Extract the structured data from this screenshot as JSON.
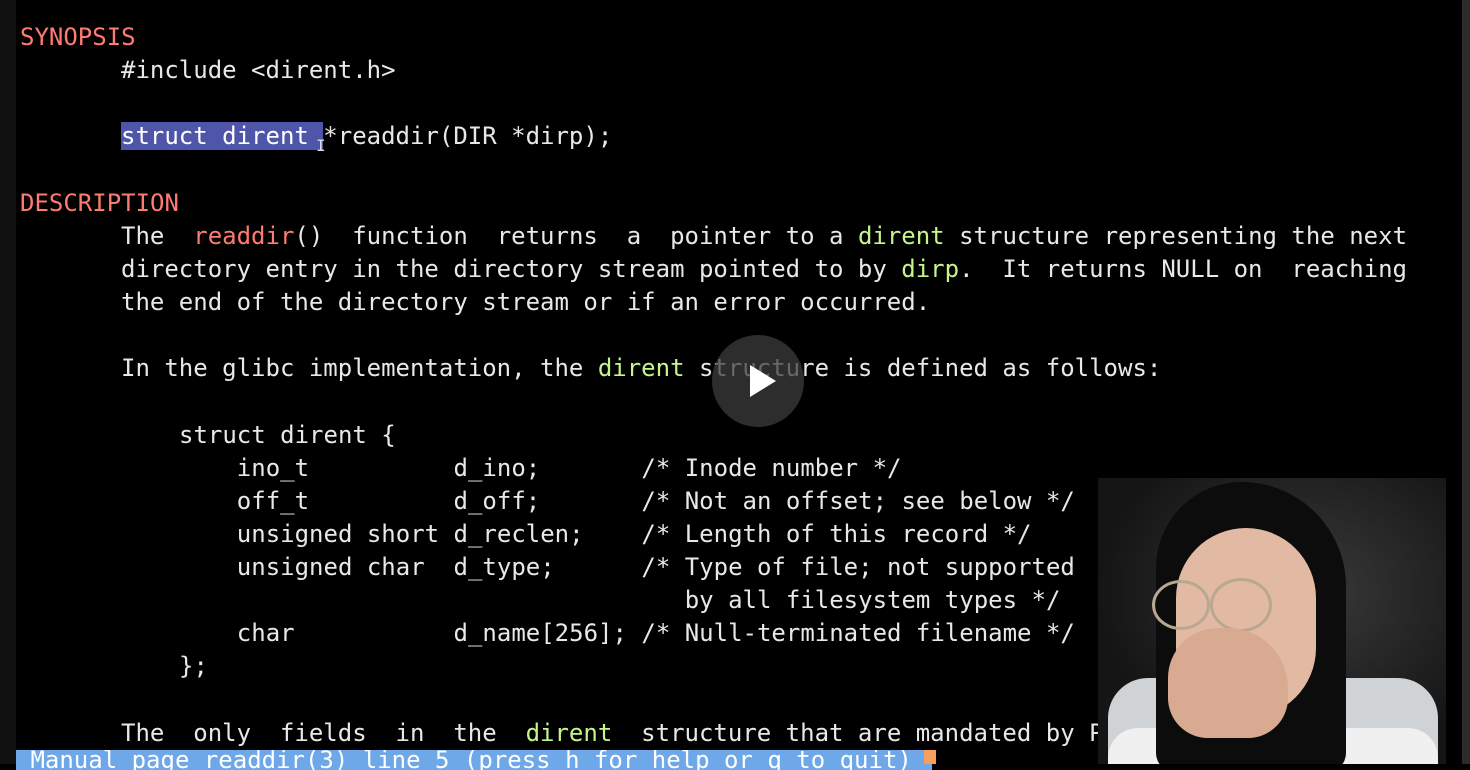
{
  "man_page": {
    "synopsis_header": "SYNOPSIS",
    "include_line": "#include <dirent.h>",
    "proto_selected": "struct dirent ",
    "proto_rest": "*readdir(DIR *dirp);",
    "description_header": "DESCRIPTION",
    "desc_p1_l1": {
      "a": "The  ",
      "fn": "readdir",
      "b": "()  function  returns  a  pointer to a ",
      "kw": "dirent",
      "c": " structure representing the next"
    },
    "desc_p1_l2": {
      "a": "directory entry in the directory stream pointed to by ",
      "kw": "dirp",
      "b": ".  It returns NULL on  reaching"
    },
    "desc_p1_l3": "the end of the directory stream or if an error occurred.",
    "desc_p2": {
      "a": "In the glibc implementation, the ",
      "kw": "dirent",
      "b": " structure is defined as follows:"
    },
    "struct_lines": [
      "struct dirent {",
      "    ino_t          d_ino;       /* Inode number */",
      "    off_t          d_off;       /* Not an offset; see below */",
      "    unsigned short d_reclen;    /* Length of this record */",
      "    unsigned char  d_type;      /* Type of file; not supported",
      "                                   by all filesystem types */",
      "    char           d_name[256]; /* Null-terminated filename */",
      "};"
    ],
    "desc_p3": {
      "a": "The  only  fields  in  the  ",
      "kw": "dirent",
      "b": "  structure that are mandated by P"
    }
  },
  "status_bar": {
    "text": " Manual page readdir(3) line 5 (press h for help or q to quit)"
  },
  "colors": {
    "header": "#ff7a70",
    "keyword": "#c6f58a",
    "selection": "#4f55a8",
    "status_bar": "#6ea8e8"
  },
  "icons": {
    "play": "play-icon",
    "cursor": "text-cursor-icon"
  }
}
